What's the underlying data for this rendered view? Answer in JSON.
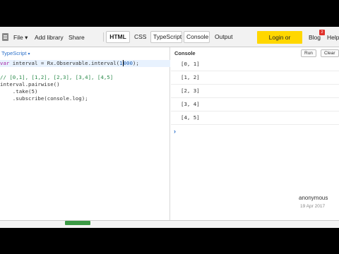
{
  "toolbar": {
    "file_label": "File",
    "file_caret": "▾",
    "add_library_label": "Add library",
    "share_label": "Share",
    "tabs": [
      {
        "label": "HTML"
      },
      {
        "label": "CSS"
      },
      {
        "label": "TypeScript"
      },
      {
        "label": "Console"
      },
      {
        "label": "Output"
      }
    ],
    "login_label": "Login or Register",
    "blog_label": "Blog",
    "blog_badge": "2",
    "help_label": "Help"
  },
  "editor": {
    "language_label": "TypeScript",
    "language_caret": "▾",
    "code": {
      "l1_kw": "var",
      "l1_a": " interval = Rx.Observable.interval(",
      "l1_num_a": "1",
      "l1_num_b": "000",
      "l1_end": ");",
      "l2": "// [0,1], [1,2], [2,3], [3,4], [4,5]",
      "l3": "interval.pairwise()",
      "l4": "    .take(5)",
      "l5": "    .subscribe(console.log);"
    }
  },
  "console": {
    "title": "Console",
    "run_label": "Run",
    "clear_label": "Clear",
    "lines": [
      "[0, 1]",
      "[1, 2]",
      "[2, 3]",
      "[3, 4]",
      "[4, 5]"
    ],
    "prompt": "›"
  },
  "author": {
    "name": "anonymous",
    "date": "19 Apr 2017"
  },
  "colors": {
    "accent": "#2a6fc9",
    "login_bg": "#ffd700",
    "badge": "#e0302a",
    "comment": "#2a8a4a"
  }
}
